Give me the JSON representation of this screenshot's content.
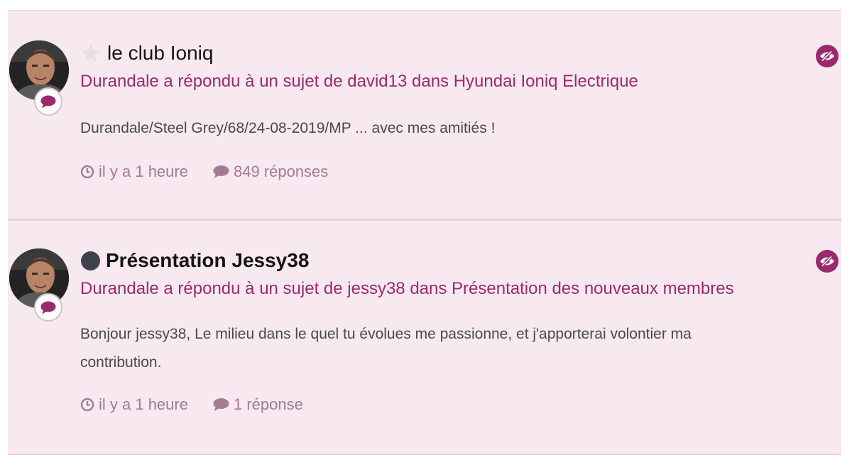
{
  "colors": {
    "card_background": "#f7e9ef",
    "accent": "#9b2a6d",
    "meta_text": "#a57a94"
  },
  "items": [
    {
      "title": "le club Ioniq",
      "state_icon": "star-icon",
      "action": "Durandale a répondu à un sujet de david13 dans Hyundai Ioniq Electrique",
      "snippet": "Durandale/Steel Grey/68/24-08-2019/MP ... avec mes amitiés !",
      "time": "il y a 1 heure",
      "replies": "849 réponses"
    },
    {
      "title": "Présentation Jessy38",
      "state_icon": "unread-dot-icon",
      "action": "Durandale a répondu à un sujet de jessy38 dans Présentation des nouveaux membres",
      "snippet": "Bonjour jessy38, Le milieu dans le quel tu évolues me passionne, et j'apporterai volontier ma\ncontribution.",
      "time": "il y a 1 heure",
      "replies": "1 réponse"
    }
  ]
}
